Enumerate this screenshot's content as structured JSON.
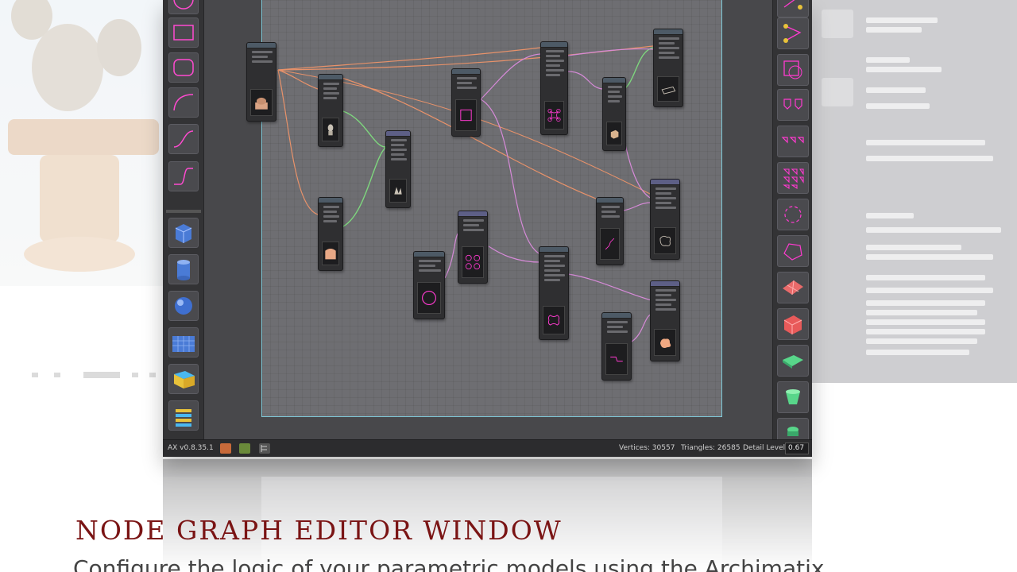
{
  "app": {
    "version": "AX v0.8.35.1",
    "status": {
      "vertices_label": "Vertices: 30557",
      "triangles_label": "Triangles: 26585",
      "detail_label": "Detail Level",
      "detail_value": "0.67"
    }
  },
  "caption": {
    "title": "Node Graph Editor Window",
    "subtitle": "Configure the logic of your parametric models using the Archimatix"
  },
  "colors": {
    "canvas": "#6e6e72",
    "wire_orange": "#e8926a",
    "wire_green": "#7ed67e",
    "wire_pink": "#d68ad8",
    "shape_magenta": "#ff3ad0",
    "title_red": "#7a1414"
  },
  "icons": {
    "left_toolbar": [
      "circle-shape-icon",
      "rectangle-shape-icon",
      "rounded-rectangle-icon",
      "curve-icon",
      "s-curve-icon",
      "step-curve-icon",
      "cube-icon",
      "cylinder-icon",
      "sphere-icon",
      "grid-plane-icon",
      "extrude-icon",
      "stack-icon"
    ],
    "right_toolbar": [
      "merge-icon",
      "combine-icon",
      "corner-shape-icon",
      "mirror-icon",
      "repeat-icon",
      "grid-repeat-icon",
      "radial-repeat-icon",
      "polygon-icon",
      "plane-icon",
      "box-icon",
      "slab-icon",
      "column-icon",
      "lamp-icon"
    ]
  }
}
